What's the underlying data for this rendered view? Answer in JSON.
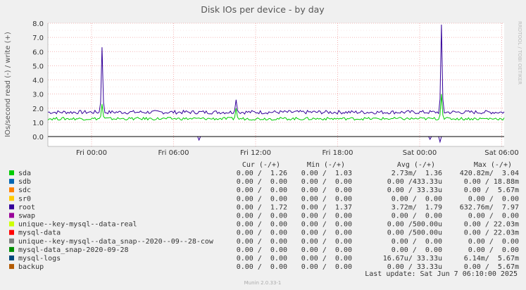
{
  "chart_data": {
    "type": "line",
    "title": "Disk IOs per device - by day",
    "ylabel": "IOs/second read (-) / write (+)",
    "side_label": "RRDTOOL / TOBI OETIKER",
    "footer": "Munin 2.0.33-1",
    "ylim": [
      -0.3,
      8.0
    ],
    "yticks": [
      "8.0",
      "7.0",
      "6.0",
      "5.0",
      "4.0",
      "3.0",
      "2.0",
      "1.0",
      "0.0"
    ],
    "xticks": [
      "Fri 00:00",
      "Fri 06:00",
      "Fri 12:00",
      "Fri 18:00",
      "Sat 00:00",
      "Sat 06:00"
    ],
    "grid": true,
    "series": [
      {
        "name": "root",
        "color": "#330099",
        "write_baseline": 1.72,
        "write_noise": 0.13,
        "write_peaks": [
          [
            0.12,
            6.3
          ],
          [
            0.414,
            2.6
          ],
          [
            0.862,
            7.9
          ]
        ],
        "read_baseline": 0.0,
        "read_dips": [
          [
            0.33,
            -0.25
          ],
          [
            0.838,
            -0.2
          ],
          [
            0.86,
            -0.38
          ]
        ]
      },
      {
        "name": "sda",
        "color": "#00cc00",
        "write_baseline": 1.26,
        "write_noise": 0.1,
        "write_peaks": [
          [
            0.12,
            2.3
          ],
          [
            0.414,
            2.0
          ],
          [
            0.862,
            3.0
          ]
        ],
        "read_baseline": 0.0,
        "read_dips": []
      }
    ],
    "legend_header": {
      "cur": "Cur (-/+)",
      "min": "Min (-/+)",
      "avg": "Avg (-/+)",
      "max": "Max (-/+)"
    },
    "legend": [
      {
        "name": "sda",
        "color": "#00cc00",
        "cur": "0.00 /  1.26",
        "min": "0.00 /  1.03",
        "avg": "2.73m/  1.36",
        "max": "420.82m/  3.04"
      },
      {
        "name": "sdb",
        "color": "#0066b3",
        "cur": "0.00 /  0.00",
        "min": "0.00 /  0.00",
        "avg": "0.00 /433.33u",
        "max": "0.00 / 18.88m"
      },
      {
        "name": "sdc",
        "color": "#ff8000",
        "cur": "0.00 /  0.00",
        "min": "0.00 /  0.00",
        "avg": "0.00 / 33.33u",
        "max": "0.00 /  5.67m"
      },
      {
        "name": "sr0",
        "color": "#ffcc00",
        "cur": "0.00 /  0.00",
        "min": "0.00 /  0.00",
        "avg": "0.00 /  0.00",
        "max": "0.00 /  0.00"
      },
      {
        "name": "root",
        "color": "#330099",
        "cur": "0.00 /  1.72",
        "min": "0.00 /  1.37",
        "avg": "3.72m/  1.79",
        "max": "632.76m/  7.97"
      },
      {
        "name": "swap",
        "color": "#990099",
        "cur": "0.00 /  0.00",
        "min": "0.00 /  0.00",
        "avg": "0.00 /  0.00",
        "max": "0.00 /  0.00"
      },
      {
        "name": "unique--key-mysql--data-real",
        "color": "#ccff00",
        "cur": "0.00 /  0.00",
        "min": "0.00 /  0.00",
        "avg": "0.00 /500.00u",
        "max": "0.00 / 22.03m"
      },
      {
        "name": "mysql-data",
        "color": "#ff0000",
        "cur": "0.00 /  0.00",
        "min": "0.00 /  0.00",
        "avg": "0.00 /500.00u",
        "max": "0.00 / 22.03m"
      },
      {
        "name": "unique--key-mysql--data_snap--2020--09--28-cow",
        "color": "#808080",
        "cur": "0.00 /  0.00",
        "min": "0.00 /  0.00",
        "avg": "0.00 /  0.00",
        "max": "0.00 /  0.00"
      },
      {
        "name": "mysql-data_snap-2020-09-28",
        "color": "#008f00",
        "cur": "0.00 /  0.00",
        "min": "0.00 /  0.00",
        "avg": "0.00 /  0.00",
        "max": "0.00 /  0.00"
      },
      {
        "name": "mysql-logs",
        "color": "#00487d",
        "cur": "0.00 /  0.00",
        "min": "0.00 /  0.00",
        "avg": "16.67u/ 33.33u",
        "max": "6.14m/  5.67m"
      },
      {
        "name": "backup",
        "color": "#b35a00",
        "cur": "0.00 /  0.00",
        "min": "0.00 /  0.00",
        "avg": "0.00 / 33.33u",
        "max": "0.00 /  5.67m"
      }
    ],
    "last_update": "Last update:  Sat Jun  7 06:10:00 2025"
  }
}
